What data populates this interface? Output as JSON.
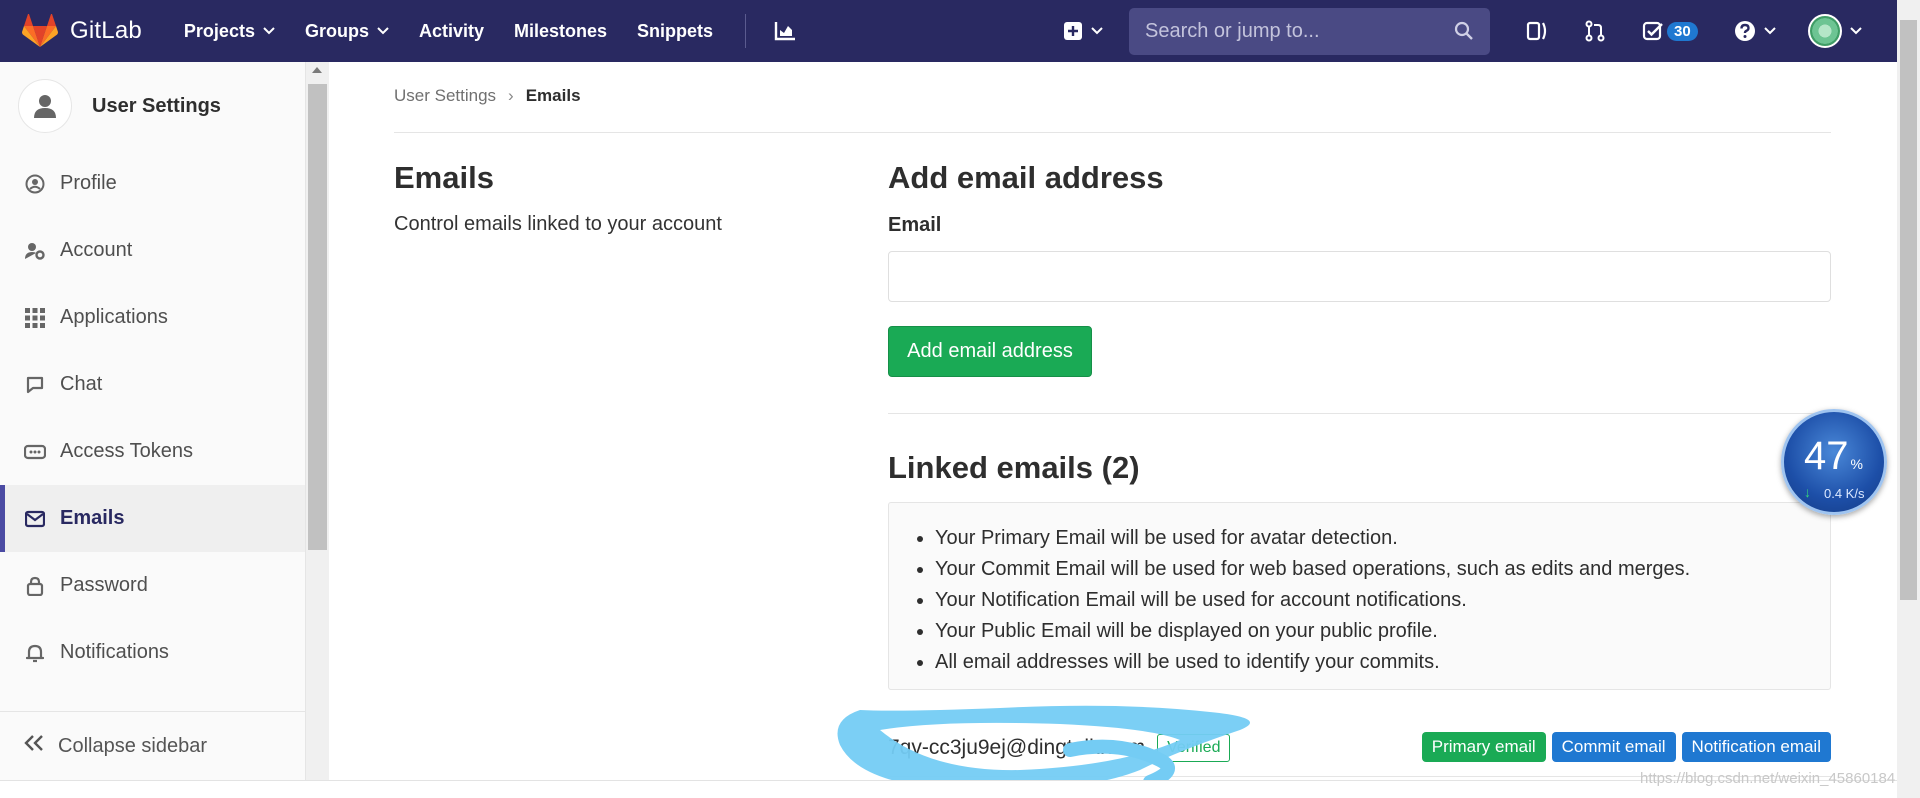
{
  "topbar": {
    "brand": "GitLab",
    "nav": [
      {
        "label": "Projects",
        "dropdown": true
      },
      {
        "label": "Groups",
        "dropdown": true
      },
      {
        "label": "Activity",
        "dropdown": false
      },
      {
        "label": "Milestones",
        "dropdown": false
      },
      {
        "label": "Snippets",
        "dropdown": false
      }
    ],
    "search_placeholder": "Search or jump to...",
    "todo_count": "30"
  },
  "sidebar": {
    "title": "User Settings",
    "items": [
      {
        "label": "Profile",
        "icon": "profile-icon",
        "active": false
      },
      {
        "label": "Account",
        "icon": "account-icon",
        "active": false
      },
      {
        "label": "Applications",
        "icon": "applications-icon",
        "active": false
      },
      {
        "label": "Chat",
        "icon": "chat-icon",
        "active": false
      },
      {
        "label": "Access Tokens",
        "icon": "token-icon",
        "active": false
      },
      {
        "label": "Emails",
        "icon": "mail-icon",
        "active": true
      },
      {
        "label": "Password",
        "icon": "lock-icon",
        "active": false
      },
      {
        "label": "Notifications",
        "icon": "bell-icon",
        "active": false
      }
    ],
    "collapse_label": "Collapse sidebar"
  },
  "breadcrumb": {
    "parent": "User Settings",
    "current": "Emails"
  },
  "left": {
    "title": "Emails",
    "description": "Control emails linked to your account"
  },
  "add_email": {
    "title": "Add email address",
    "label": "Email",
    "value": "",
    "button": "Add email address"
  },
  "linked": {
    "title": "Linked emails (2)",
    "info": [
      "Your Primary Email will be used for avatar detection.",
      "Your Commit Email will be used for web based operations, such as edits and merges.",
      "Your Notification Email will be used for account notifications.",
      "Your Public Email will be displayed on your public profile.",
      "All email addresses will be used to identify your commits."
    ],
    "emails": [
      {
        "address": "7qv-cc3ju9ej@dingtalk.com",
        "status": "Verified",
        "badges": [
          "Primary email",
          "Commit email",
          "Notification email"
        ]
      }
    ]
  },
  "overlay": {
    "percent": "47",
    "percent_unit": "%",
    "rate": "0.4 K/s"
  },
  "watermark": "https://blog.csdn.net/weixin_45860184",
  "colors": {
    "nav_bg": "#292961",
    "green": "#1aaa55",
    "blue": "#1f78d1",
    "active_bar": "#4b4ba3"
  }
}
